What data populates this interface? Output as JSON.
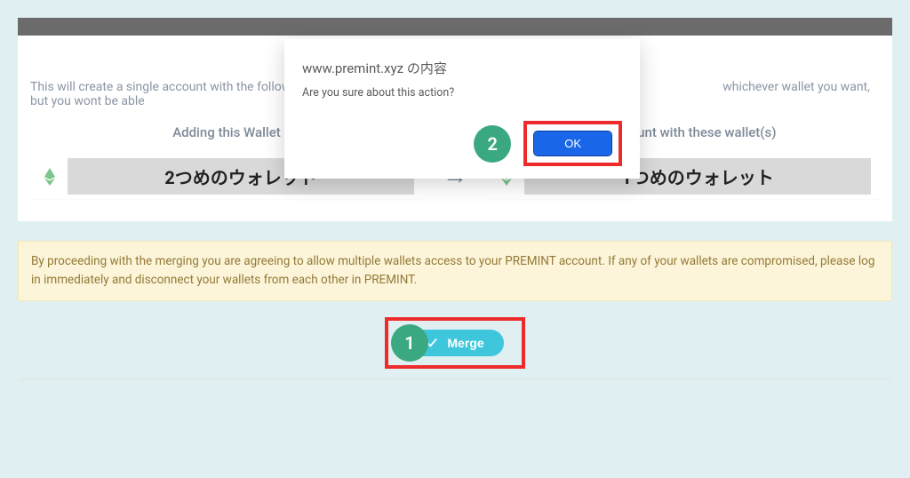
{
  "dialog": {
    "title": "www.premint.xyz の内容",
    "message": "Are you sure about this action?",
    "ok_label": "OK"
  },
  "page": {
    "intro_left": "This will create a single account with the following",
    "intro_right": "whichever wallet you want, but you wont be able"
  },
  "left_wallet": {
    "header": "Adding this Wallet",
    "label": "2つめのウォレット"
  },
  "right_wallet": {
    "header": "To account with these wallet(s)",
    "label": "1つめのウォレット"
  },
  "arrow_glyph": "→",
  "warning": "By proceeding with the merging you are agreeing to allow multiple wallets access to your PREMINT account. If any of your wallets are compromised, please log in immediately and disconnect your wallets from each other in PREMINT.",
  "merge_button": "Merge",
  "steps": {
    "one": "1",
    "two": "2"
  }
}
